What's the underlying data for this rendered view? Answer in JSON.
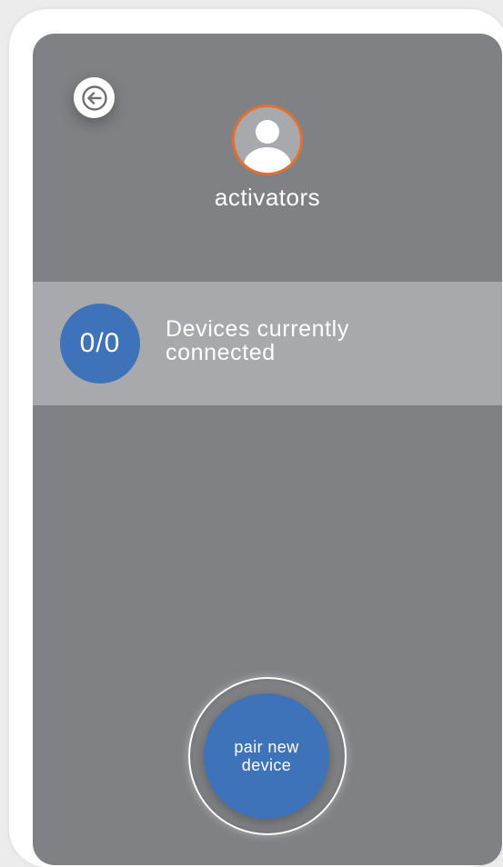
{
  "colors": {
    "screen_bg": "#808184",
    "band_bg": "#a8a9ad",
    "accent_blue": "#3e73b9",
    "avatar_ring": "#e46f2e"
  },
  "header": {
    "back_icon": "arrow-left-icon",
    "avatar_icon": "user-avatar-icon",
    "profile_name": "activators"
  },
  "status": {
    "count": "0/0",
    "label": "Devices currently connected"
  },
  "actions": {
    "pair_label": "pair new device"
  }
}
